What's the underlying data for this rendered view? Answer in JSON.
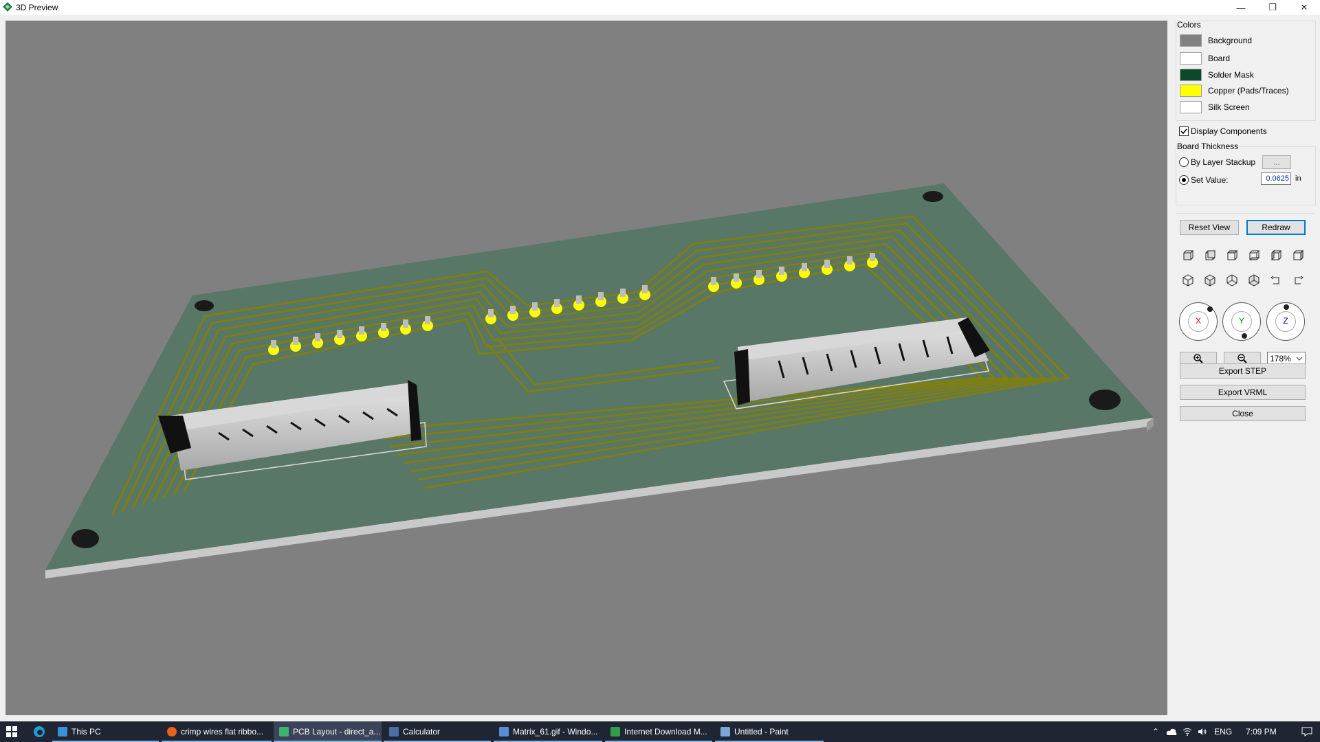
{
  "window": {
    "title": "3D Preview",
    "minimize_glyph": "—",
    "restore_glyph": "❐",
    "close_glyph": "✕"
  },
  "panel": {
    "colors_group": {
      "label": "Colors",
      "items": [
        {
          "label": "Background",
          "color": "#808080"
        },
        {
          "label": "Board",
          "color": "#ffffff"
        },
        {
          "label": "Solder Mask",
          "color": "#0a4a2a"
        },
        {
          "label": "Copper (Pads/Traces)",
          "color": "#ffff00"
        },
        {
          "label": "Silk Screen",
          "color": "#ffffff"
        }
      ]
    },
    "display_components": {
      "label": "Display Components",
      "checked": true
    },
    "board_thickness": {
      "label": "Board Thickness",
      "by_layer_stackup": "By Layer Stackup",
      "ellipsis_button": "...",
      "set_value": "Set Value:",
      "value": "0.0625",
      "unit": "in",
      "selected": "set_value"
    },
    "reset_view": "Reset View",
    "redraw": "Redraw",
    "view_icons_row1": [
      "view-front-icon",
      "view-back-icon",
      "view-top-icon",
      "view-bottom-icon",
      "view-left-icon",
      "view-right-icon"
    ],
    "view_icons_row2": [
      "iso-view-1-icon",
      "iso-view-2-icon",
      "iso-view-3-icon",
      "iso-view-4-icon",
      "rotate-left-icon",
      "rotate-right-icon"
    ],
    "rotation": {
      "x": "X",
      "y": "Y",
      "z": "Z"
    },
    "zoom_level": "178%",
    "export_step": "Export STEP",
    "export_vrml": "Export VRML",
    "close": "Close"
  },
  "taskbar": {
    "items": [
      {
        "label": "This PC",
        "icon_color": "#3b8fd9",
        "active": false
      },
      {
        "label": "crimp wires flat ribbo...",
        "icon_color": "#e8621c",
        "active": false
      },
      {
        "label": "PCB Layout - direct_a...",
        "icon_color": "#3cb371",
        "active": true
      },
      {
        "label": "Calculator",
        "icon_color": "#4a6fa5",
        "active": false
      },
      {
        "label": "Matrix_61.gif - Windo...",
        "icon_color": "#5b8dd6",
        "active": false
      },
      {
        "label": "Internet Download M...",
        "icon_color": "#2e9e48",
        "active": false
      },
      {
        "label": "Untitled - Paint",
        "icon_color": "#7aa7d8",
        "active": false
      }
    ],
    "language": "ENG",
    "time": "7:09 PM"
  }
}
